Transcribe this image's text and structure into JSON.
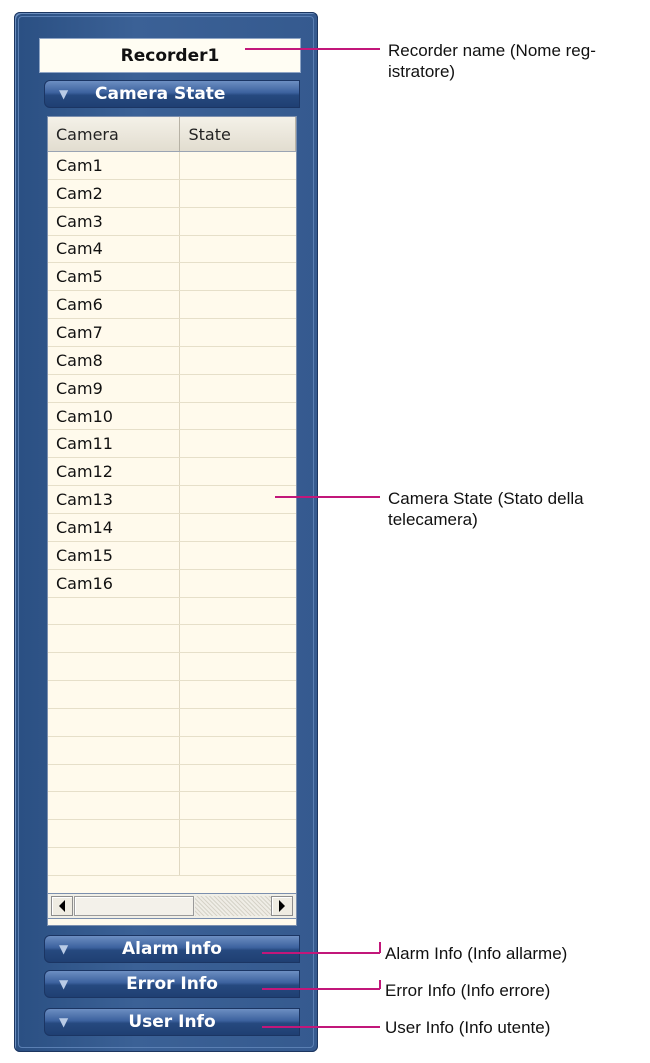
{
  "recorder": {
    "name": "Recorder1"
  },
  "sections": {
    "camera_state": "Camera State",
    "alarm_info": "Alarm Info",
    "error_info": "Error Info",
    "user_info": "User Info"
  },
  "table": {
    "columns": [
      "Camera",
      "State"
    ],
    "rows": [
      [
        "Cam1",
        ""
      ],
      [
        "Cam2",
        ""
      ],
      [
        "Cam3",
        ""
      ],
      [
        "Cam4",
        ""
      ],
      [
        "Cam5",
        ""
      ],
      [
        "Cam6",
        ""
      ],
      [
        "Cam7",
        ""
      ],
      [
        "Cam8",
        ""
      ],
      [
        "Cam9",
        ""
      ],
      [
        "Cam10",
        ""
      ],
      [
        "Cam11",
        ""
      ],
      [
        "Cam12",
        ""
      ],
      [
        "Cam13",
        ""
      ],
      [
        "Cam14",
        ""
      ],
      [
        "Cam15",
        ""
      ],
      [
        "Cam16",
        ""
      ],
      [
        "",
        ""
      ],
      [
        "",
        ""
      ],
      [
        "",
        ""
      ],
      [
        "",
        ""
      ],
      [
        "",
        ""
      ],
      [
        "",
        ""
      ],
      [
        "",
        ""
      ],
      [
        "",
        ""
      ],
      [
        "",
        ""
      ],
      [
        "",
        ""
      ]
    ]
  },
  "annotations": {
    "recorder_name": "Recorder name (Nome reg-\nistratore)",
    "camera_state": "Camera State (Stato della\ntelecamera)",
    "alarm_info": "Alarm Info (Info allarme)",
    "error_info": "Error Info (Info errore)",
    "user_info": "User Info (Info utente)"
  },
  "colors": {
    "frame": "#355a8f",
    "annotation_line": "#c2177a",
    "panel_bg": "#fffaec"
  }
}
